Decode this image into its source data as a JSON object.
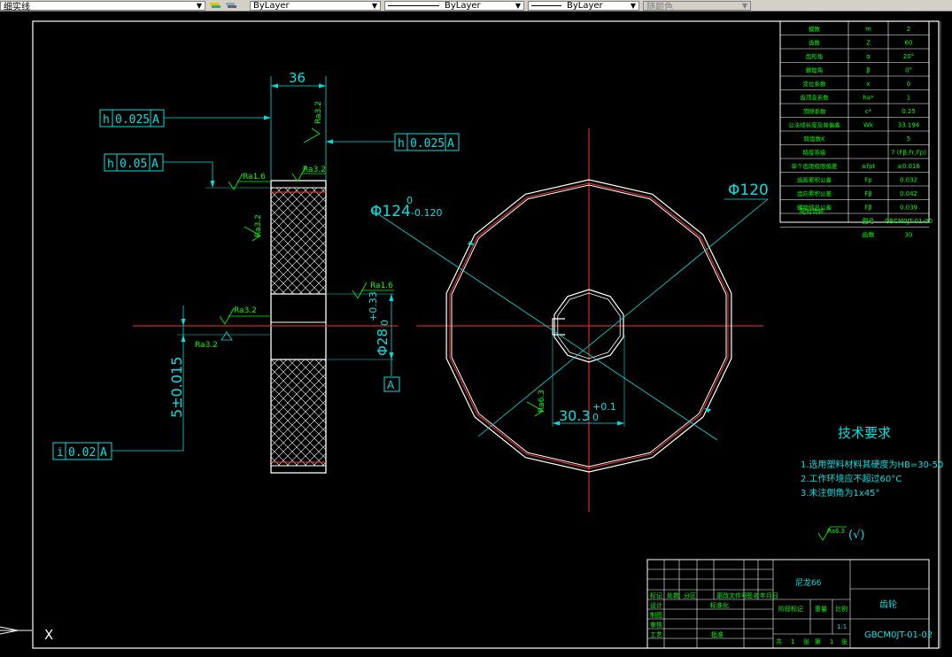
{
  "toolbar": {
    "layer_name": "细实线",
    "color": "ByLayer",
    "linetype": "ByLayer",
    "lineweight": "ByLayer",
    "plotstyle": "随颜色"
  },
  "dims": {
    "width_36": "36",
    "dia_124": "Φ124",
    "dia_124_upper": "0",
    "dia_124_lower": "-0.120",
    "dia_120": "Φ120",
    "bore": "Φ28",
    "bore_tol": "+0.33",
    "bore_tol2": "0",
    "keyway": "30.3",
    "keyway_tol": "+0.1",
    "keyway_tol2": "0",
    "vertical": "5±0.015"
  },
  "fcf": {
    "f1": [
      "h",
      "0.025",
      "A"
    ],
    "f2": [
      "h",
      "0.025",
      "A"
    ],
    "f3": [
      "h",
      "0.05",
      "A"
    ],
    "f4": [
      "i",
      "0.02",
      "A"
    ],
    "datum": "A"
  },
  "rough": {
    "r1": "Ra3.2",
    "r2": "Ra1.6",
    "r3": "Ra3.2",
    "r4": "Ra3.2",
    "r5": "Ra1.6",
    "r6": "Ra3.2",
    "r7": "Ra3.2",
    "r8": "Ra6.3",
    "r9": "Ra3.2"
  },
  "params": {
    "rows": [
      [
        "模数",
        "m",
        "2"
      ],
      [
        "齿数",
        "Z",
        "60"
      ],
      [
        "齿形角",
        "α",
        "20°"
      ],
      [
        "螺旋角",
        "β",
        "0°"
      ],
      [
        "变位系数",
        "x",
        "0"
      ],
      [
        "齿顶高系数",
        "ha*",
        "1"
      ],
      [
        "顶隙系数",
        "c*",
        "0.25"
      ],
      [
        "公法线长度及其偏差",
        "Wk",
        "33.194"
      ],
      [
        "跨齿数K",
        "",
        "5"
      ],
      [
        "精度等级",
        "",
        "7 (Fβ,Fr,Fp)"
      ],
      [
        "单个齿距极限偏差",
        "±fpt",
        "±0.016"
      ],
      [
        "齿距累积公差",
        "Fp",
        "0.032"
      ],
      [
        "齿向累积公差",
        "Fβ",
        "0.042"
      ],
      [
        "螺旋线总公差",
        "Fβ",
        "0.039"
      ]
    ],
    "mate_label": "配对齿轮",
    "mate_rows": [
      [
        "图号",
        "GBCM0JT-01-00"
      ],
      [
        "齿数",
        "30"
      ]
    ]
  },
  "tech": {
    "title": "技术要求",
    "items": [
      "1.选用塑料材料其硬度为HB=30-50",
      "2.工作环境应不超过60°C",
      "3.未注倒角为1x45°"
    ],
    "other_rough": "Ra6.3",
    "other_paren": "(√)"
  },
  "titleblock": {
    "material": "尼龙66",
    "part_name": "齿轮",
    "drawing_no": "GBCM0JT-01-02",
    "scale": "1:1",
    "h_mark": "标记",
    "h_count": "处数",
    "h_zone": "分区",
    "h_doc": "更改文件号",
    "h_sign": "签名",
    "h_date": "年月日",
    "design": "设计",
    "standard": "标准化",
    "draft": "制图",
    "check": "审核",
    "process": "工艺",
    "approve": "批准",
    "stage": "阶段标记",
    "weight": "重量",
    "ratio": "比例",
    "total": "共",
    "sheets": "张",
    "no": "第",
    "one": "1",
    "one2": "1"
  },
  "ucs_x": "X"
}
